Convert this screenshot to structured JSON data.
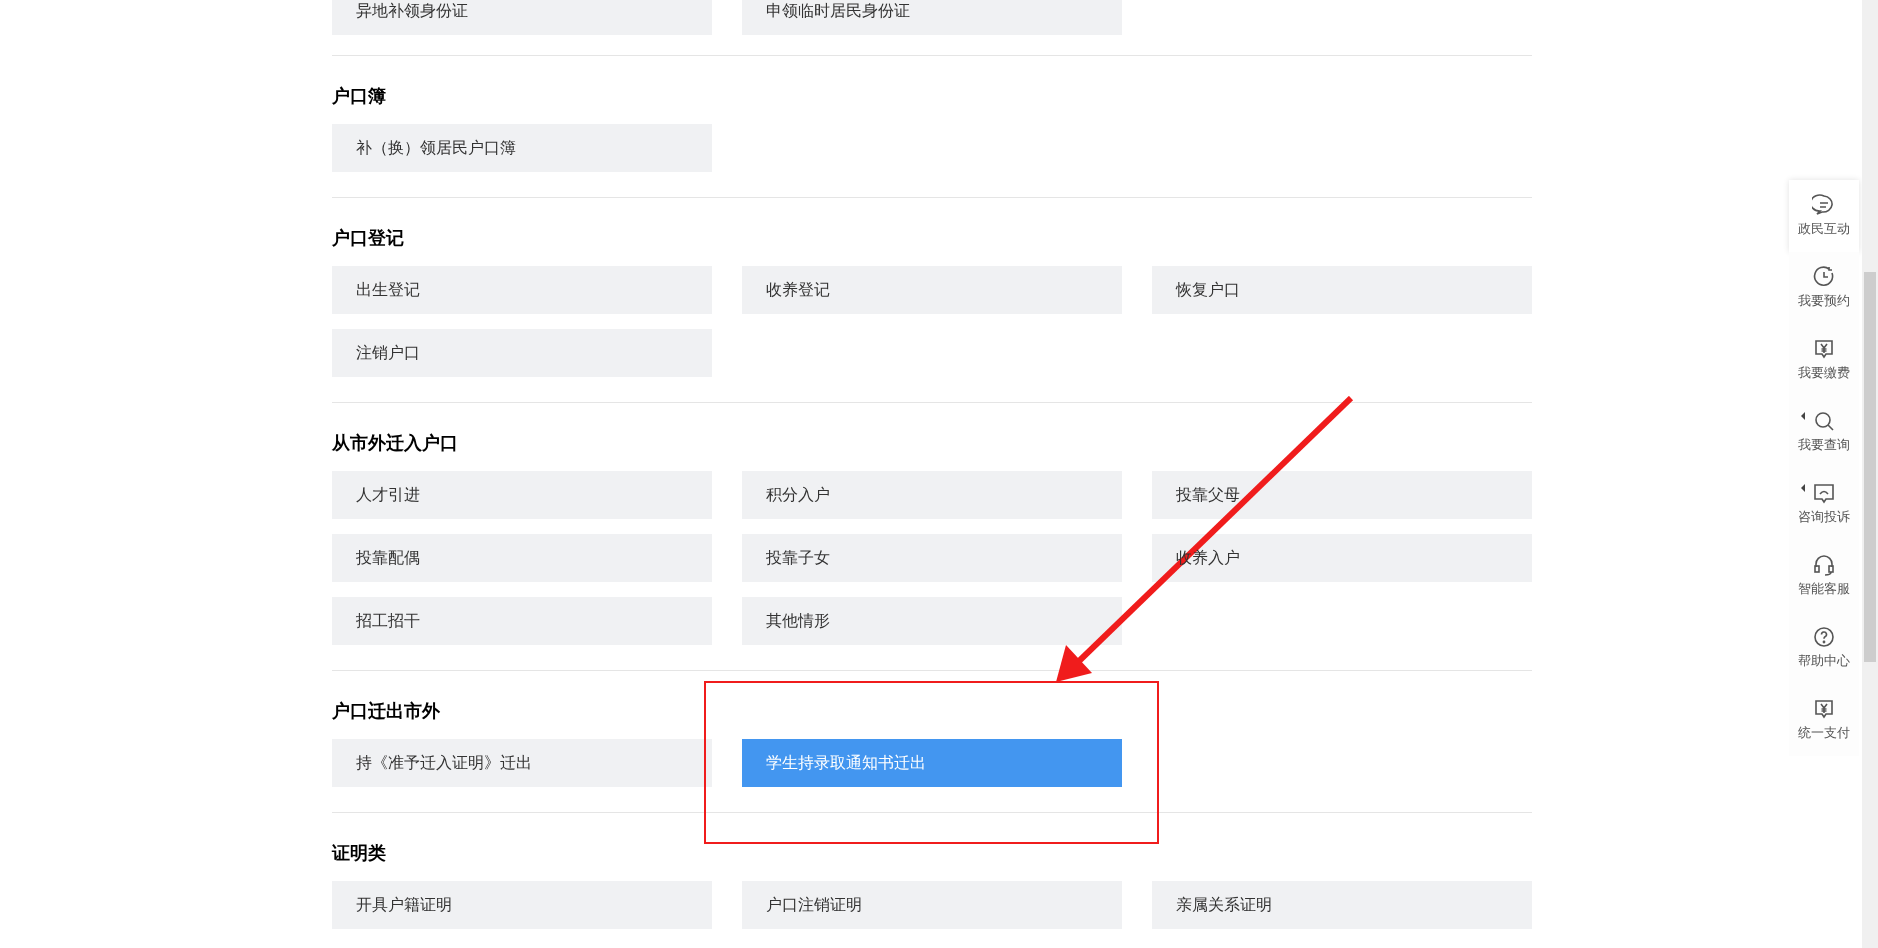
{
  "sections": [
    {
      "items": [
        {
          "label": "异地补领身份证",
          "selected": false
        },
        {
          "label": "申领临时居民身份证",
          "selected": false
        }
      ]
    },
    {
      "title": "户口簿",
      "items": [
        {
          "label": "补（换）领居民户口簿",
          "selected": false
        }
      ]
    },
    {
      "title": "户口登记",
      "items": [
        {
          "label": "出生登记",
          "selected": false
        },
        {
          "label": "收养登记",
          "selected": false
        },
        {
          "label": "恢复户口",
          "selected": false
        },
        {
          "label": "注销户口",
          "selected": false
        }
      ]
    },
    {
      "title": "从市外迁入户口",
      "items": [
        {
          "label": "人才引进",
          "selected": false
        },
        {
          "label": "积分入户",
          "selected": false
        },
        {
          "label": "投靠父母",
          "selected": false
        },
        {
          "label": "投靠配偶",
          "selected": false
        },
        {
          "label": "投靠子女",
          "selected": false
        },
        {
          "label": "收养入户",
          "selected": false
        },
        {
          "label": "招工招干",
          "selected": false
        },
        {
          "label": "其他情形",
          "selected": false
        }
      ]
    },
    {
      "title": "户口迁出市外",
      "items": [
        {
          "label": "持《准予迁入证明》迁出",
          "selected": false
        },
        {
          "label": "学生持录取通知书迁出",
          "selected": true
        }
      ]
    },
    {
      "title": "证明类",
      "items": [
        {
          "label": "开具户籍证明",
          "selected": false
        },
        {
          "label": "户口注销证明",
          "selected": false
        },
        {
          "label": "亲属关系证明",
          "selected": false
        }
      ]
    }
  ],
  "sidebar": [
    {
      "label": "政民互动",
      "kind": "chat",
      "selected": true,
      "submenu": false
    },
    {
      "label": "我要预约",
      "kind": "clock",
      "selected": false,
      "submenu": false
    },
    {
      "label": "我要缴费",
      "kind": "yen",
      "selected": false,
      "submenu": false
    },
    {
      "label": "我要查询",
      "kind": "search",
      "selected": false,
      "submenu": true
    },
    {
      "label": "咨询投诉",
      "kind": "screen",
      "selected": false,
      "submenu": true
    },
    {
      "label": "智能客服",
      "kind": "headset",
      "selected": false,
      "submenu": false
    },
    {
      "label": "帮助中心",
      "kind": "help",
      "selected": false,
      "submenu": false
    },
    {
      "label": "统一支付",
      "kind": "yen",
      "selected": false,
      "submenu": false
    }
  ]
}
